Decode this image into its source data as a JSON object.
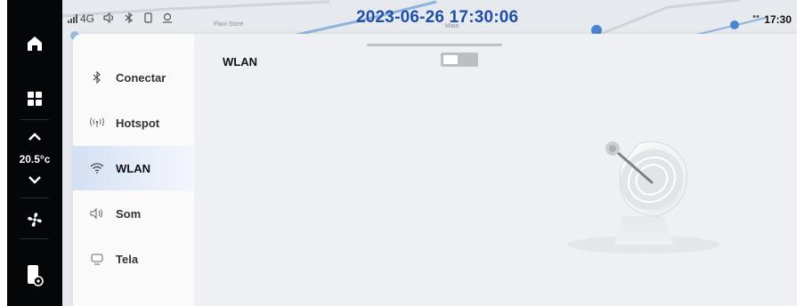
{
  "status_bar": {
    "signal": "4G",
    "datetime": "2023-06-26 17:30:06",
    "clock": "17:30",
    "map_label_1": "Flavi Store",
    "map_label_2": "Maia"
  },
  "dock": {
    "items": [
      {
        "icon": "home-icon"
      },
      {
        "icon": "apps-grid-icon"
      },
      {
        "icon": "fan-icon"
      },
      {
        "icon": "phone-settings-icon"
      }
    ],
    "temperature": "20.5°c"
  },
  "panel": {
    "menu": [
      {
        "label": "Conectar",
        "icon": "bluetooth-icon"
      },
      {
        "label": "Hotspot",
        "icon": "hotspot-icon"
      },
      {
        "label": "WLAN",
        "icon": "wifi-icon"
      },
      {
        "label": "Som",
        "icon": "speaker-icon"
      },
      {
        "label": "Tela",
        "icon": "display-icon"
      }
    ],
    "active_index": 2,
    "content": {
      "title": "WLAN",
      "toggle_on": false
    }
  },
  "colors": {
    "accent": "#1f4fa8",
    "active_bg": "#d3e0f3",
    "dock_bg": "#050607"
  }
}
